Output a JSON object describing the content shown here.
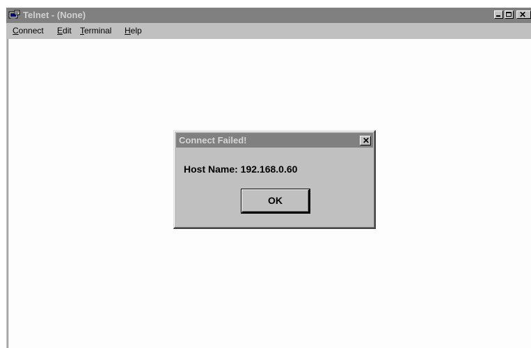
{
  "window": {
    "title": "Telnet - (None)",
    "icon": "telnet-app-icon",
    "controls": {
      "minimize": "minimize-icon",
      "maximize": "maximize-icon",
      "close": "close-icon"
    }
  },
  "menu": {
    "items": [
      {
        "accel": "C",
        "rest": "onnect"
      },
      {
        "accel": "E",
        "rest": "dit"
      },
      {
        "accel": "T",
        "rest": "erminal"
      },
      {
        "accel": "H",
        "rest": "elp"
      }
    ]
  },
  "dialog": {
    "title": "Connect Failed!",
    "message": "Host Name: 192.168.0.60",
    "ok_label": "OK",
    "close_glyph": "✕"
  },
  "colors": {
    "title_bar_inactive": "#808080",
    "face": "#c0c0c0",
    "client_background": "#fdfdfd"
  }
}
